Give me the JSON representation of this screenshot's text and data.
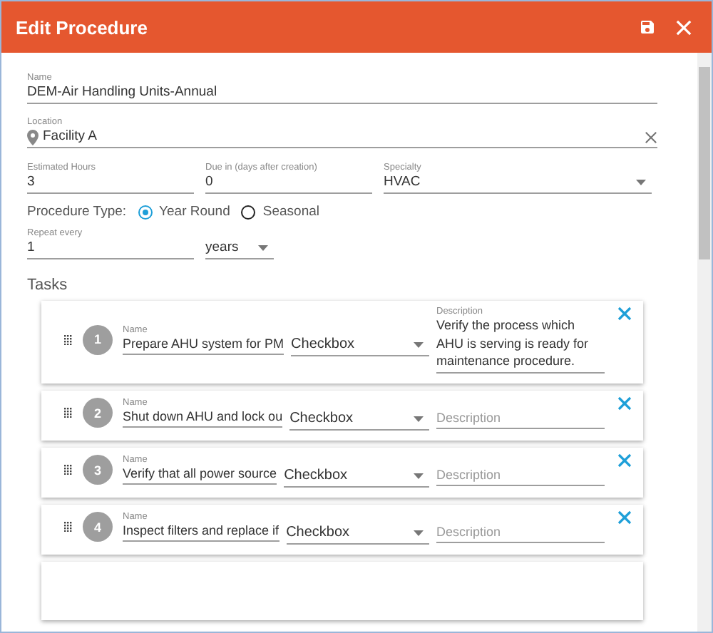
{
  "window": {
    "title": "Edit Procedure"
  },
  "form": {
    "name": {
      "label": "Name",
      "value": "DEM-Air Handling Units-Annual"
    },
    "location": {
      "label": "Location",
      "value": "Facility A"
    },
    "estimated_hours": {
      "label": "Estimated Hours",
      "value": "3"
    },
    "due_in": {
      "label": "Due in (days after creation)",
      "value": "0"
    },
    "specialty": {
      "label": "Specialty",
      "value": "HVAC"
    },
    "procedure_type": {
      "label": "Procedure Type:",
      "options": [
        {
          "label": "Year Round",
          "selected": true
        },
        {
          "label": "Seasonal",
          "selected": false
        }
      ]
    },
    "repeat": {
      "label": "Repeat every",
      "value": "1",
      "unit": "years"
    }
  },
  "tasks": {
    "title": "Tasks",
    "items": [
      {
        "number": "1",
        "name_label": "Name",
        "name": "Prepare AHU system for PM",
        "type": "Checkbox",
        "description_label": "Description",
        "description": "Verify the process which AHU is serving is ready for maintenance procedure."
      },
      {
        "number": "2",
        "name_label": "Name",
        "name": "Shut down AHU and lock ou",
        "type": "Checkbox",
        "description_placeholder": "Description"
      },
      {
        "number": "3",
        "name_label": "Name",
        "name": "Verify that all power source",
        "type": "Checkbox",
        "description_placeholder": "Description"
      },
      {
        "number": "4",
        "name_label": "Name",
        "name": "Inspect filters and replace if",
        "type": "Checkbox",
        "description_placeholder": "Description"
      }
    ]
  }
}
